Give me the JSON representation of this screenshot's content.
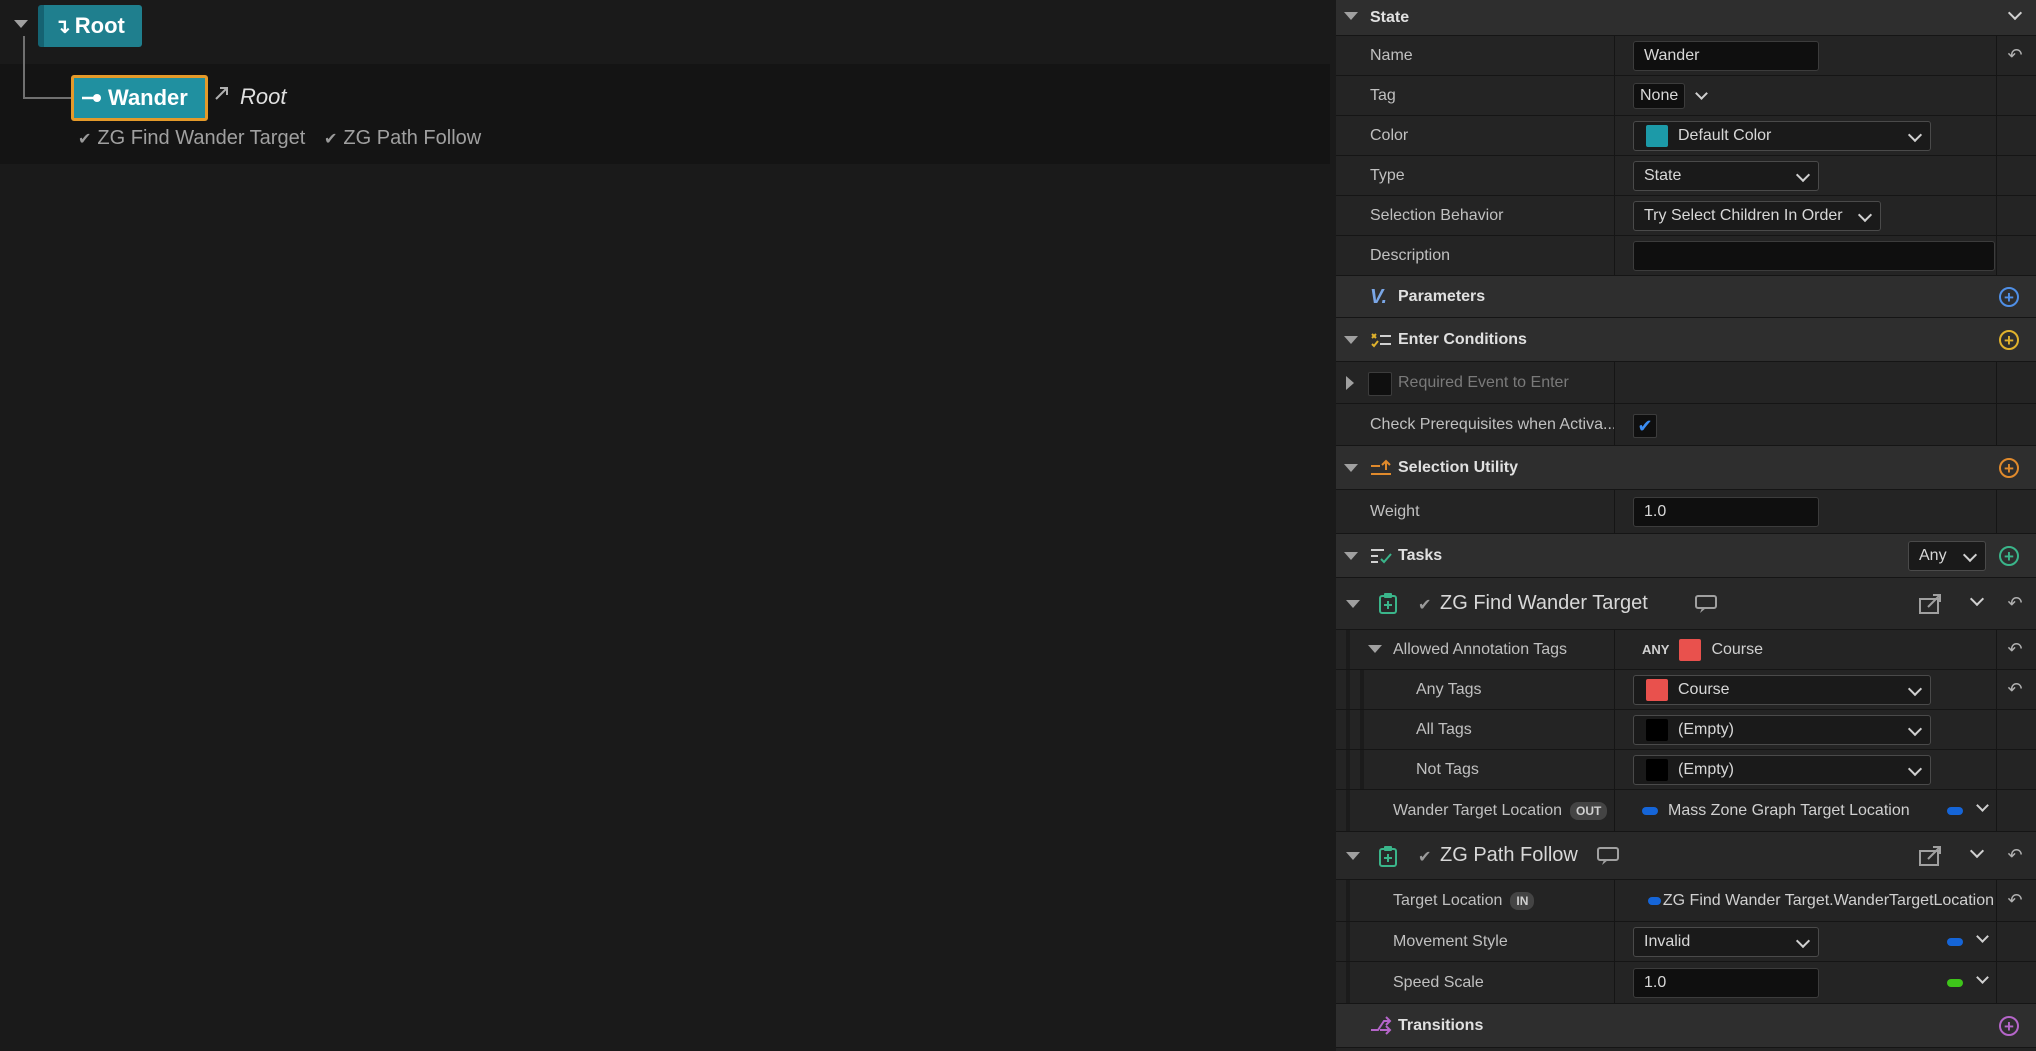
{
  "tree": {
    "root_label": "Root",
    "state_label": "Wander",
    "link_label": "Root",
    "tasks": [
      "ZG Find Wander Target",
      "ZG Path Follow"
    ]
  },
  "panel": {
    "state_section": "State",
    "name_label": "Name",
    "name_value": "Wander",
    "tag_label": "Tag",
    "tag_value": "None",
    "color_label": "Color",
    "color_value": "Default Color",
    "color_swatch": "#1c9aa8",
    "type_label": "Type",
    "type_value": "State",
    "selection_behavior_label": "Selection Behavior",
    "selection_behavior_value": "Try Select Children In Order",
    "description_label": "Description",
    "description_value": "",
    "parameters_section": "Parameters",
    "enter_conditions_section": "Enter Conditions",
    "required_event_label": "Required Event to Enter",
    "check_prereq_label": "Check Prerequisites when Activa...",
    "check_prereq_value": true,
    "selection_utility_section": "Selection Utility",
    "weight_label": "Weight",
    "weight_value": "1.0",
    "tasks_section": "Tasks",
    "tasks_filter": "Any",
    "task1": {
      "title": "ZG Find Wander Target",
      "allowed_tags_label": "Allowed Annotation Tags",
      "allowed_tags_mode": "ANY",
      "allowed_tags_value": "Course",
      "any_tags_label": "Any Tags",
      "any_tags_value": "Course",
      "all_tags_label": "All Tags",
      "all_tags_value": "(Empty)",
      "not_tags_label": "Not Tags",
      "not_tags_value": "(Empty)",
      "wander_target_label": "Wander Target Location",
      "wander_target_badge": "OUT",
      "wander_target_value": "Mass Zone Graph Target Location"
    },
    "task2": {
      "title": "ZG Path Follow",
      "target_location_label": "Target Location",
      "target_location_badge": "IN",
      "target_location_value": "ZG Find Wander Target.WanderTargetLocation",
      "movement_style_label": "Movement Style",
      "movement_style_value": "Invalid",
      "speed_scale_label": "Speed Scale",
      "speed_scale_value": "1.0"
    },
    "transitions_section": "Transitions"
  },
  "colors": {
    "tag_red": "#e9514d",
    "pin_blue": "#1565d8",
    "pin_green": "#3ec41a",
    "plus_blue": "#4f8fe6",
    "plus_yellow": "#e0b22c",
    "plus_orange": "#e08a2c",
    "plus_green": "#3ab58a",
    "plus_purple": "#b565c9",
    "check_blue": "#3a8cf2"
  }
}
